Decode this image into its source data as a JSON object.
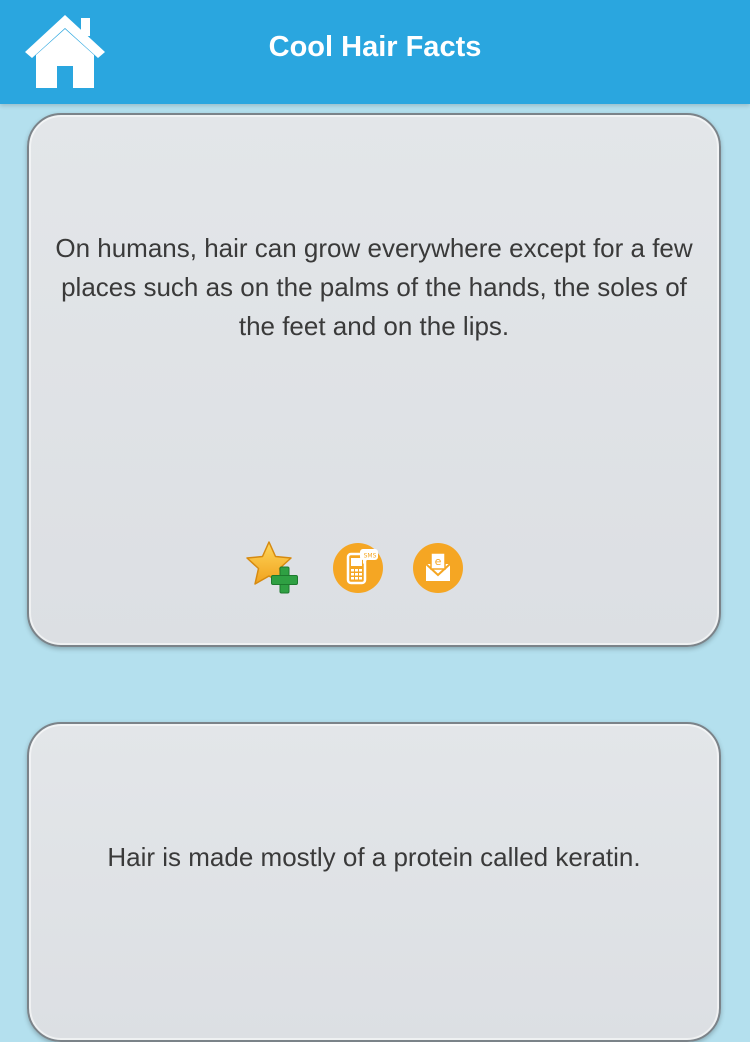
{
  "header": {
    "title": "Cool Hair Facts",
    "home_icon": "home-icon",
    "background": "#2aa6df"
  },
  "facts": [
    {
      "text": "On humans, hair can grow everywhere except for a few places such as on the palms of the hands, the soles of the feet and on the lips.",
      "actions": [
        {
          "icon": "add-favorite-star-icon"
        },
        {
          "icon": "sms-phone-icon",
          "badge": "SMS"
        },
        {
          "icon": "email-envelope-icon",
          "badge": "e"
        }
      ]
    },
    {
      "text": "Hair is made mostly of a protein called keratin."
    }
  ],
  "colors": {
    "page_background": "#b4e0ee",
    "card_background": "#e0e3e6",
    "action_orange": "#f5a623",
    "plus_green": "#2fa043"
  }
}
